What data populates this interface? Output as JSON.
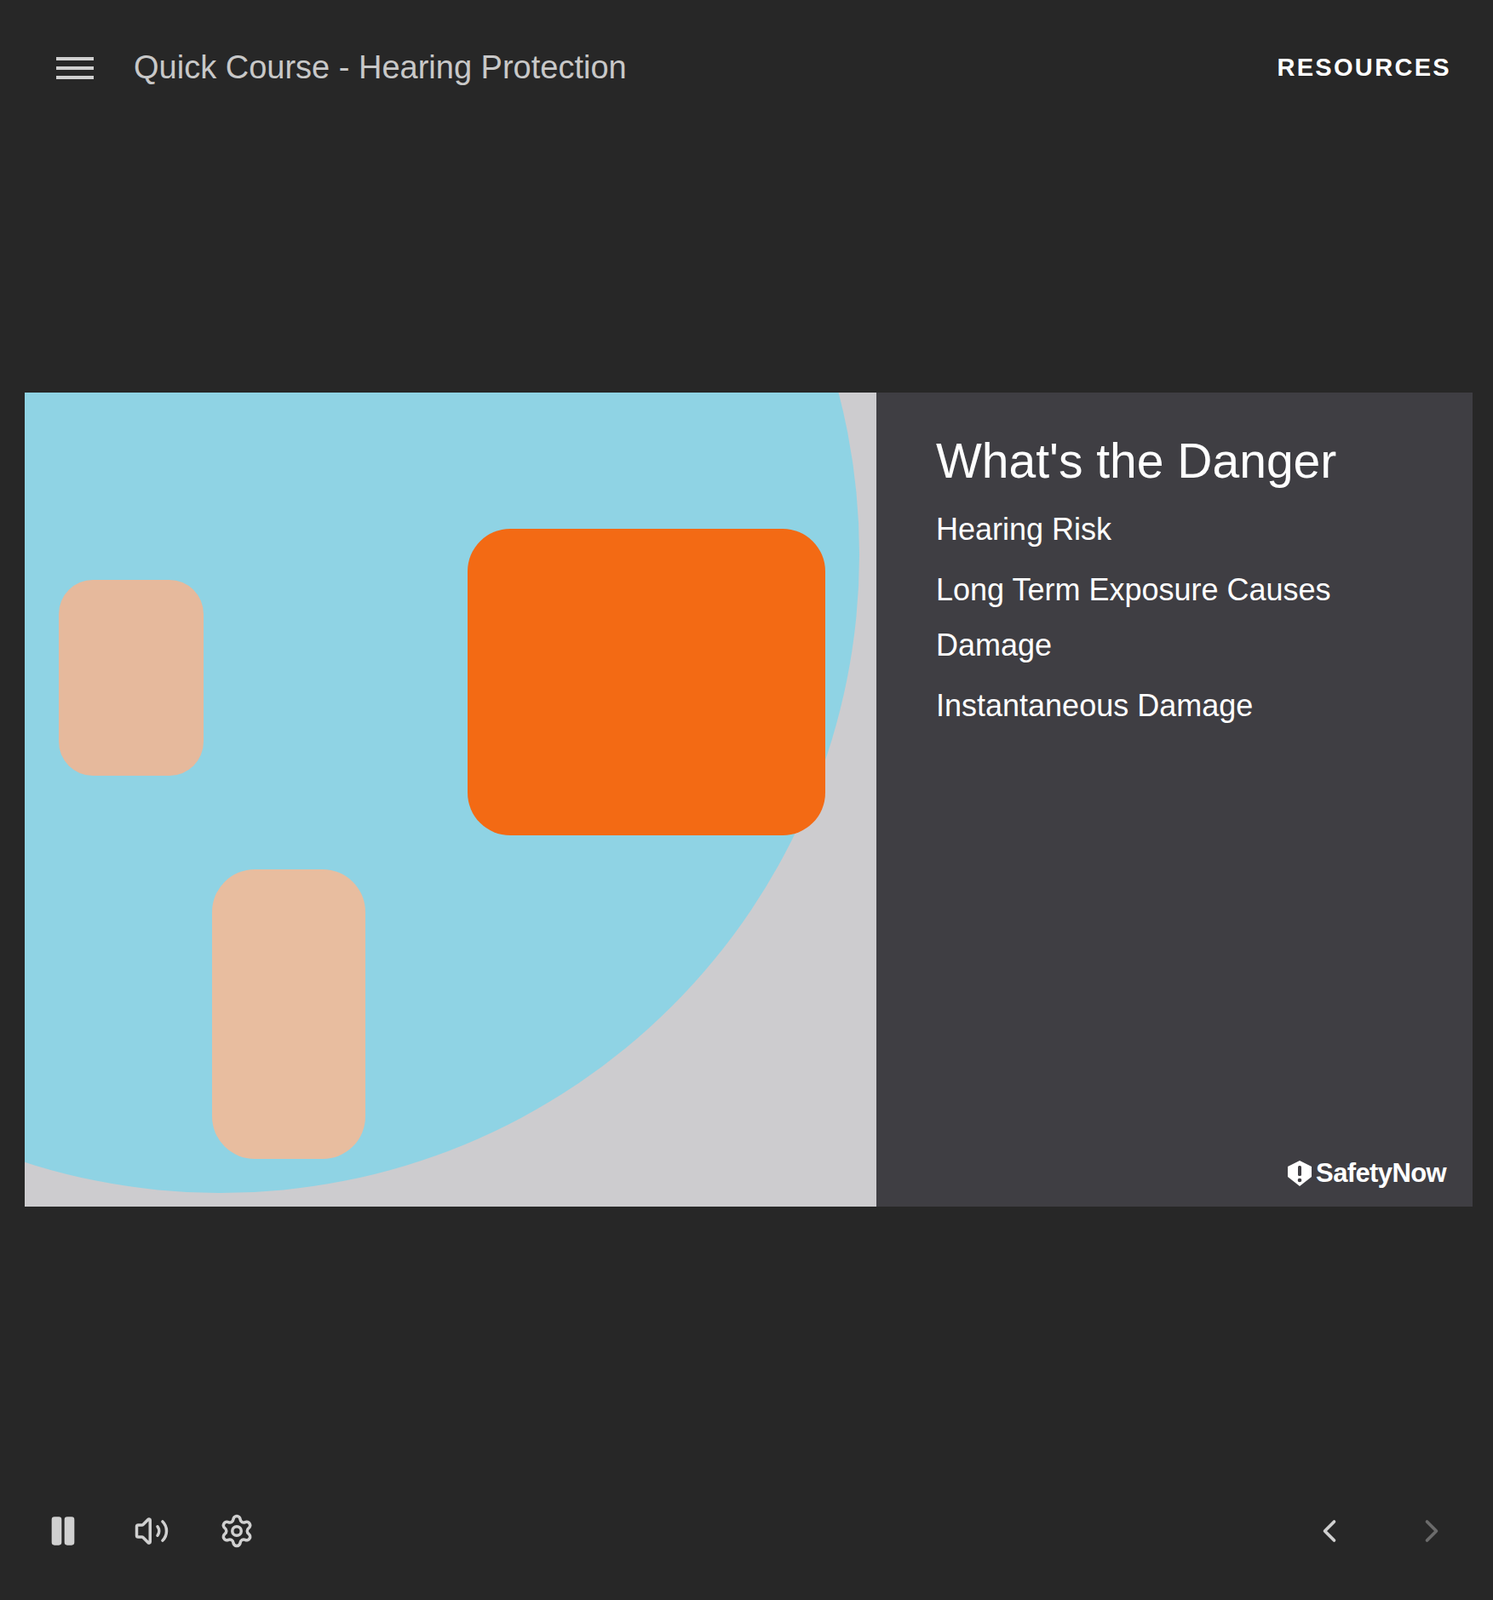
{
  "course": {
    "title": "Quick Course - Hearing Protection",
    "resources": "RESOURCES"
  },
  "slide": {
    "heading": "What's the Danger",
    "items": [
      "Hearing Risk",
      "Long Term Exposure Causes Damage",
      "Instantaneous Damage"
    ],
    "brand": "SafetyNow"
  },
  "player": {
    "playing": true,
    "muted": false,
    "previous": {
      "disabled": false
    },
    "next": {
      "disabled": true
    }
  }
}
